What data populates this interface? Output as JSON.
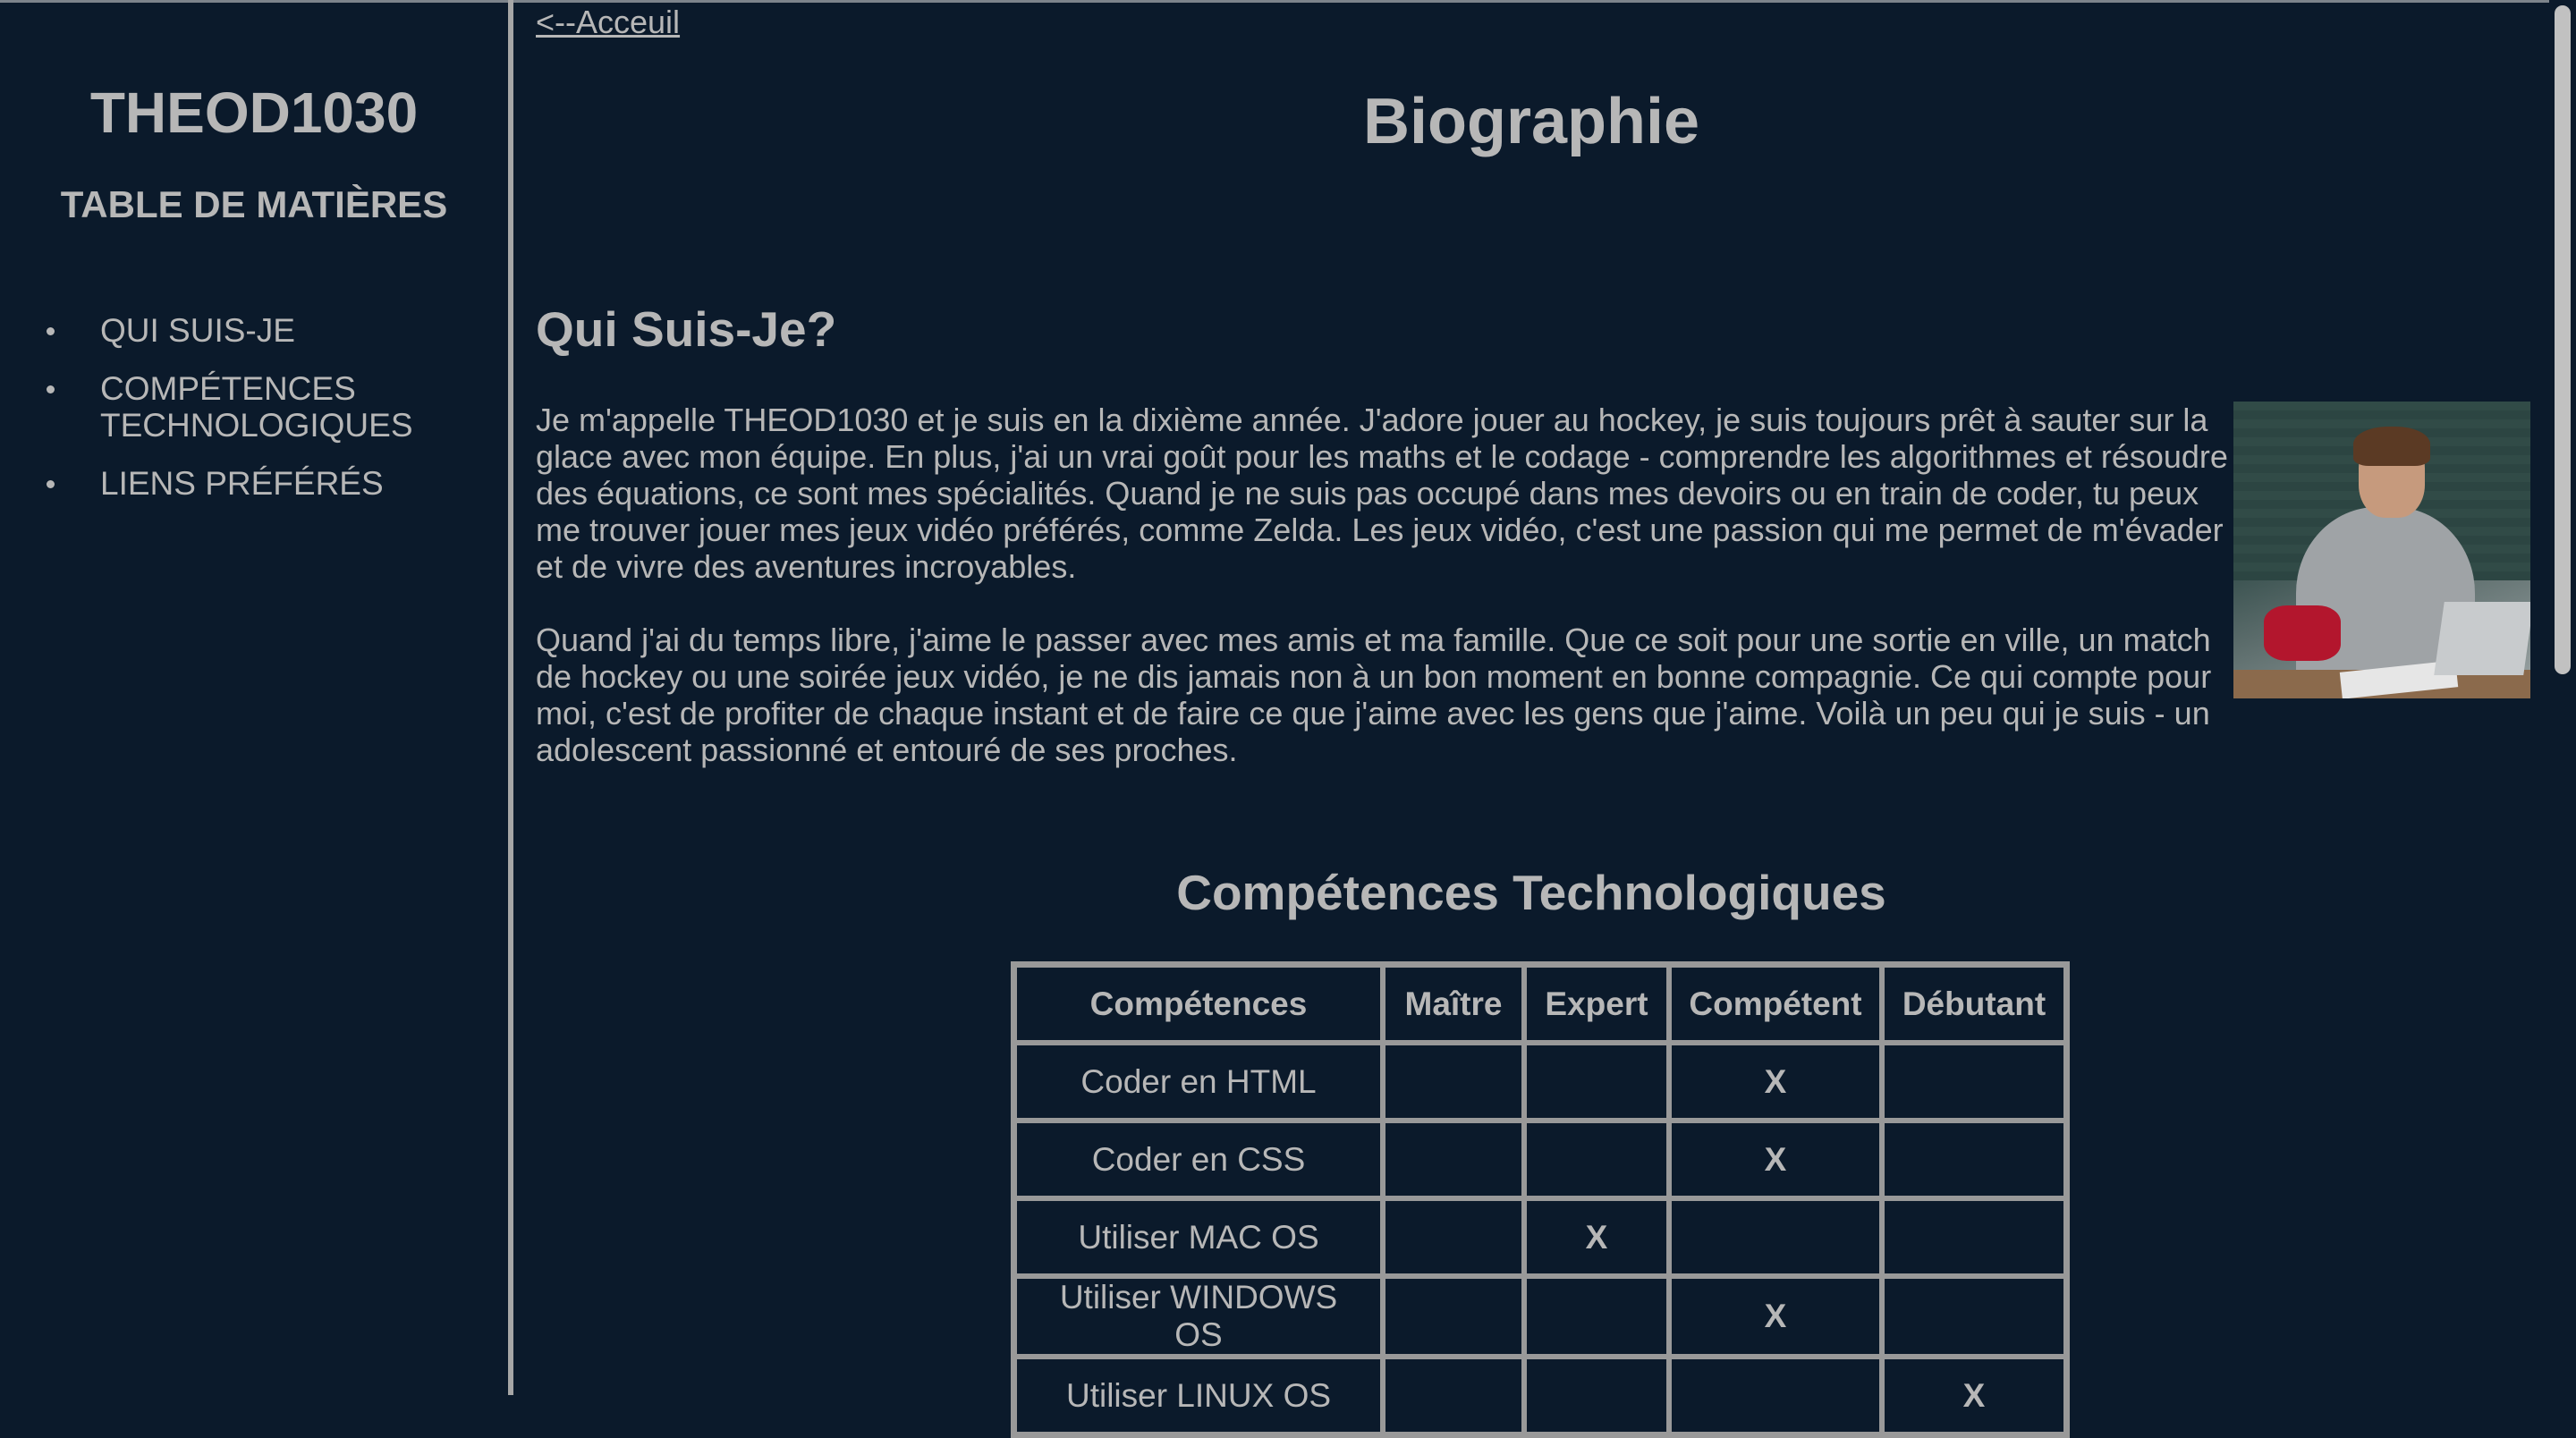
{
  "sidebar": {
    "site_title": "THEOD1030",
    "toc_title": "TABLE DE MATIÈRES",
    "items": [
      {
        "label": "QUI SUIS-JE"
      },
      {
        "label": "COMPÉTENCES TECHNOLOGIQUES"
      },
      {
        "label": "LIENS PRÉFÉRÉS"
      }
    ]
  },
  "main": {
    "back_link": "<--Acceuil",
    "page_title": "Biographie",
    "section_title": "Qui Suis-Je?",
    "bio_paragraphs": [
      "Je m'appelle THEOD1030 et je suis en la dixième année. J'adore jouer au hockey, je suis toujours prêt à sauter sur la glace avec mon équipe. En plus, j'ai un vrai goût pour les maths et le codage - comprendre les algorithmes et résoudre des équations, ce sont mes spécialités. Quand je ne suis pas occupé dans mes devoirs ou en train de coder, tu peux me trouver jouer mes jeux vidéo préférés, comme Zelda. Les jeux vidéo, c'est une passion qui me permet de m'évader et de vivre des aventures incroyables.",
      "Quand j'ai du temps libre, j'aime le passer avec mes amis et ma famille. Que ce soit pour une sortie en ville, un match de hockey ou une soirée jeux vidéo, je ne dis jamais non à un bon moment en bonne compagnie. Ce qui compte pour moi, c'est de profiter de chaque instant et de faire ce que j'aime avec les gens que j'aime. Voilà un peu qui je suis - un adolescent passionné et entouré de ses proches."
    ],
    "skills_title": "Compétences Technologiques",
    "table": {
      "headers": [
        "Compétences",
        "Maître",
        "Expert",
        "Compétent",
        "Débutant"
      ],
      "rows": [
        [
          "Coder en HTML",
          "",
          "",
          "X",
          ""
        ],
        [
          "Coder en CSS",
          "",
          "",
          "X",
          ""
        ],
        [
          "Utiliser MAC OS",
          "",
          "X",
          "",
          ""
        ],
        [
          "Utiliser WINDOWS OS",
          "",
          "",
          "X",
          ""
        ],
        [
          "Utiliser LINUX OS",
          "",
          "",
          "",
          "X"
        ]
      ]
    }
  },
  "colors": {
    "background": "#0b1a2b",
    "text": "#b7b7b7",
    "border": "#999999"
  }
}
